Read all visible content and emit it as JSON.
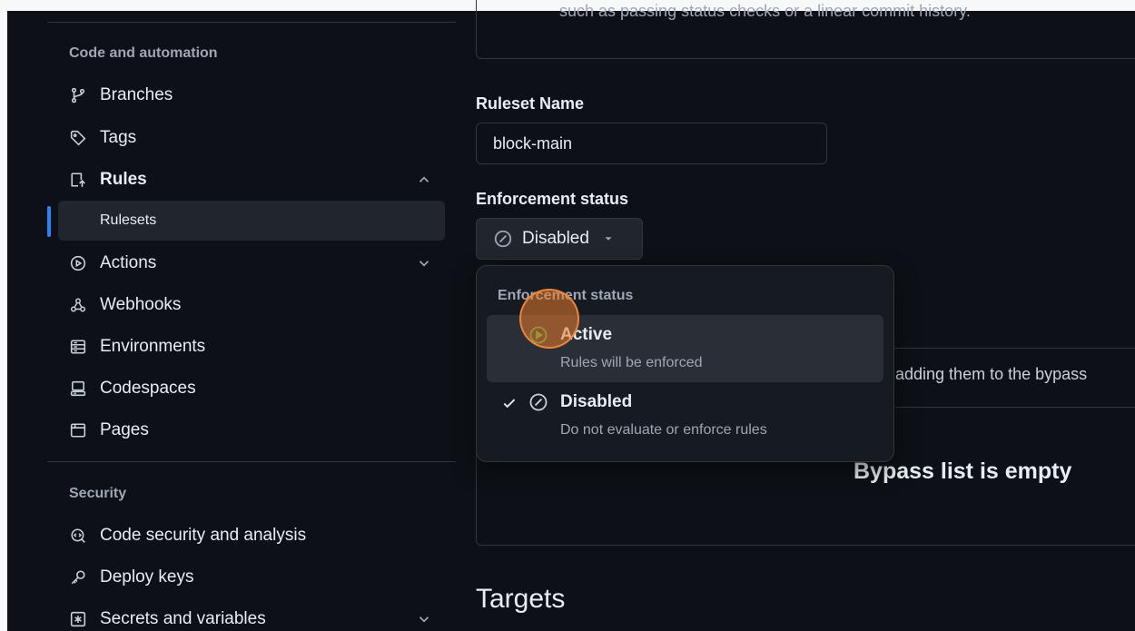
{
  "sidebar": {
    "section_code": "Code and automation",
    "section_security": "Security",
    "items": {
      "branches": "Branches",
      "tags": "Tags",
      "rules": "Rules",
      "rulesets": "Rulesets",
      "actions": "Actions",
      "webhooks": "Webhooks",
      "environments": "Environments",
      "codespaces": "Codespaces",
      "pages": "Pages",
      "code_security": "Code security and analysis",
      "deploy_keys": "Deploy keys",
      "secrets": "Secrets and variables"
    }
  },
  "main": {
    "top_box_text": "such as passing status checks or a linear commit history.",
    "ruleset_name_label": "Ruleset Name",
    "ruleset_name_value": "block-main",
    "enforcement_label": "Enforcement status",
    "enforcement_selected": "Disabled",
    "bypass_hint": "adding them to the bypass",
    "bypass_empty": "Bypass list is empty",
    "targets_title": "Targets"
  },
  "dropdown": {
    "title": "Enforcement status",
    "options": [
      {
        "name": "Active",
        "desc": "Rules will be enforced",
        "selected": false
      },
      {
        "name": "Disabled",
        "desc": "Do not evaluate or enforce rules",
        "selected": true
      }
    ]
  },
  "colors": {
    "background": "#0d1117",
    "accent_blue": "#2f81f7",
    "active_green": "#3fb950",
    "cursor_orange": "#e87828"
  },
  "icons": {
    "branches": "git-branch-icon",
    "tags": "tag-icon",
    "rules": "rules-icon",
    "actions": "play-circle-icon",
    "webhooks": "webhook-icon",
    "environments": "server-icon",
    "codespaces": "codespaces-icon",
    "pages": "browser-icon",
    "code_security": "codescan-icon",
    "deploy_keys": "key-icon",
    "secrets": "asterisk-box-icon"
  }
}
